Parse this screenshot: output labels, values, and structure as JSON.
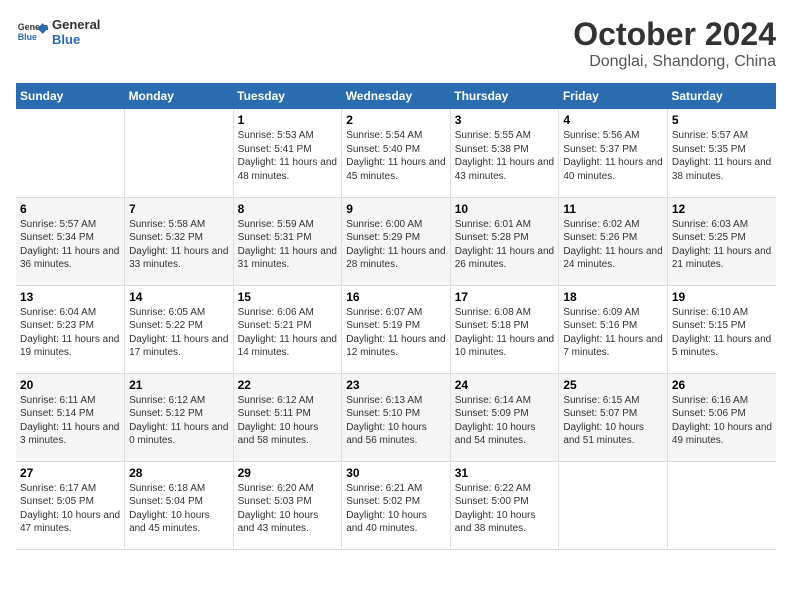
{
  "header": {
    "logo_line1": "General",
    "logo_line2": "Blue",
    "title": "October 2024",
    "subtitle": "Donglai, Shandong, China"
  },
  "calendar": {
    "days_of_week": [
      "Sunday",
      "Monday",
      "Tuesday",
      "Wednesday",
      "Thursday",
      "Friday",
      "Saturday"
    ],
    "weeks": [
      [
        {
          "day": "",
          "info": ""
        },
        {
          "day": "",
          "info": ""
        },
        {
          "day": "1",
          "info": "Sunrise: 5:53 AM\nSunset: 5:41 PM\nDaylight: 11 hours and 48 minutes."
        },
        {
          "day": "2",
          "info": "Sunrise: 5:54 AM\nSunset: 5:40 PM\nDaylight: 11 hours and 45 minutes."
        },
        {
          "day": "3",
          "info": "Sunrise: 5:55 AM\nSunset: 5:38 PM\nDaylight: 11 hours and 43 minutes."
        },
        {
          "day": "4",
          "info": "Sunrise: 5:56 AM\nSunset: 5:37 PM\nDaylight: 11 hours and 40 minutes."
        },
        {
          "day": "5",
          "info": "Sunrise: 5:57 AM\nSunset: 5:35 PM\nDaylight: 11 hours and 38 minutes."
        }
      ],
      [
        {
          "day": "6",
          "info": "Sunrise: 5:57 AM\nSunset: 5:34 PM\nDaylight: 11 hours and 36 minutes."
        },
        {
          "day": "7",
          "info": "Sunrise: 5:58 AM\nSunset: 5:32 PM\nDaylight: 11 hours and 33 minutes."
        },
        {
          "day": "8",
          "info": "Sunrise: 5:59 AM\nSunset: 5:31 PM\nDaylight: 11 hours and 31 minutes."
        },
        {
          "day": "9",
          "info": "Sunrise: 6:00 AM\nSunset: 5:29 PM\nDaylight: 11 hours and 28 minutes."
        },
        {
          "day": "10",
          "info": "Sunrise: 6:01 AM\nSunset: 5:28 PM\nDaylight: 11 hours and 26 minutes."
        },
        {
          "day": "11",
          "info": "Sunrise: 6:02 AM\nSunset: 5:26 PM\nDaylight: 11 hours and 24 minutes."
        },
        {
          "day": "12",
          "info": "Sunrise: 6:03 AM\nSunset: 5:25 PM\nDaylight: 11 hours and 21 minutes."
        }
      ],
      [
        {
          "day": "13",
          "info": "Sunrise: 6:04 AM\nSunset: 5:23 PM\nDaylight: 11 hours and 19 minutes."
        },
        {
          "day": "14",
          "info": "Sunrise: 6:05 AM\nSunset: 5:22 PM\nDaylight: 11 hours and 17 minutes."
        },
        {
          "day": "15",
          "info": "Sunrise: 6:06 AM\nSunset: 5:21 PM\nDaylight: 11 hours and 14 minutes."
        },
        {
          "day": "16",
          "info": "Sunrise: 6:07 AM\nSunset: 5:19 PM\nDaylight: 11 hours and 12 minutes."
        },
        {
          "day": "17",
          "info": "Sunrise: 6:08 AM\nSunset: 5:18 PM\nDaylight: 11 hours and 10 minutes."
        },
        {
          "day": "18",
          "info": "Sunrise: 6:09 AM\nSunset: 5:16 PM\nDaylight: 11 hours and 7 minutes."
        },
        {
          "day": "19",
          "info": "Sunrise: 6:10 AM\nSunset: 5:15 PM\nDaylight: 11 hours and 5 minutes."
        }
      ],
      [
        {
          "day": "20",
          "info": "Sunrise: 6:11 AM\nSunset: 5:14 PM\nDaylight: 11 hours and 3 minutes."
        },
        {
          "day": "21",
          "info": "Sunrise: 6:12 AM\nSunset: 5:12 PM\nDaylight: 11 hours and 0 minutes."
        },
        {
          "day": "22",
          "info": "Sunrise: 6:12 AM\nSunset: 5:11 PM\nDaylight: 10 hours and 58 minutes."
        },
        {
          "day": "23",
          "info": "Sunrise: 6:13 AM\nSunset: 5:10 PM\nDaylight: 10 hours and 56 minutes."
        },
        {
          "day": "24",
          "info": "Sunrise: 6:14 AM\nSunset: 5:09 PM\nDaylight: 10 hours and 54 minutes."
        },
        {
          "day": "25",
          "info": "Sunrise: 6:15 AM\nSunset: 5:07 PM\nDaylight: 10 hours and 51 minutes."
        },
        {
          "day": "26",
          "info": "Sunrise: 6:16 AM\nSunset: 5:06 PM\nDaylight: 10 hours and 49 minutes."
        }
      ],
      [
        {
          "day": "27",
          "info": "Sunrise: 6:17 AM\nSunset: 5:05 PM\nDaylight: 10 hours and 47 minutes."
        },
        {
          "day": "28",
          "info": "Sunrise: 6:18 AM\nSunset: 5:04 PM\nDaylight: 10 hours and 45 minutes."
        },
        {
          "day": "29",
          "info": "Sunrise: 6:20 AM\nSunset: 5:03 PM\nDaylight: 10 hours and 43 minutes."
        },
        {
          "day": "30",
          "info": "Sunrise: 6:21 AM\nSunset: 5:02 PM\nDaylight: 10 hours and 40 minutes."
        },
        {
          "day": "31",
          "info": "Sunrise: 6:22 AM\nSunset: 5:00 PM\nDaylight: 10 hours and 38 minutes."
        },
        {
          "day": "",
          "info": ""
        },
        {
          "day": "",
          "info": ""
        }
      ]
    ]
  }
}
